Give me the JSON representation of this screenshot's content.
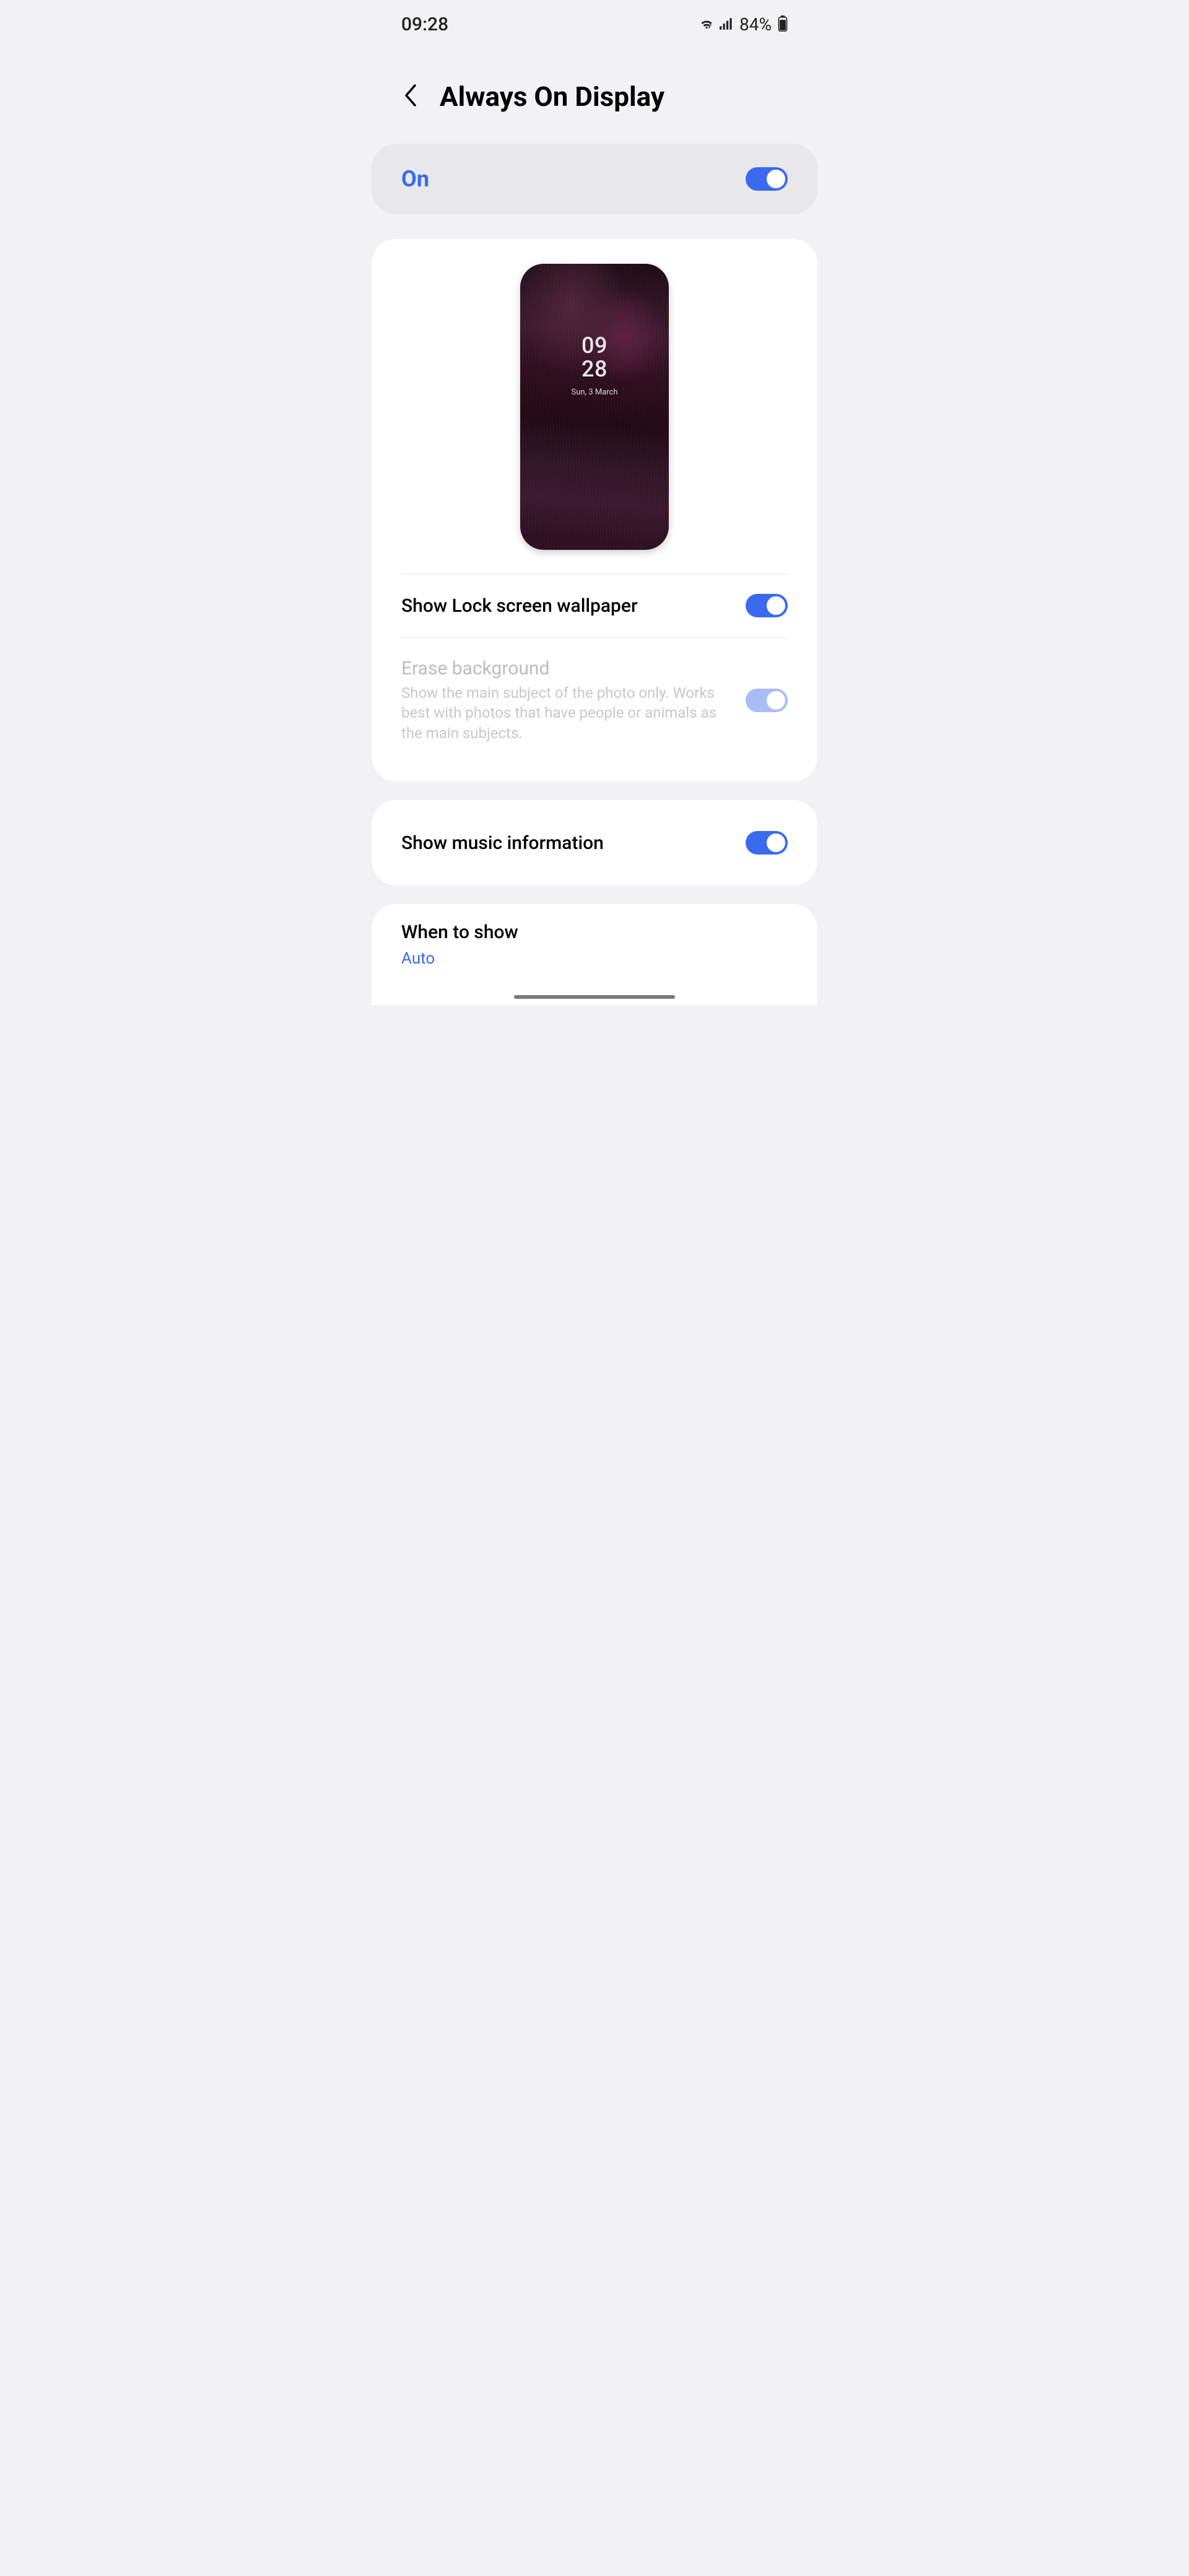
{
  "status": {
    "time": "09:28",
    "battery_pct": "84%"
  },
  "header": {
    "title": "Always On Display"
  },
  "master": {
    "label": "On",
    "on": true
  },
  "preview": {
    "hour": "09",
    "minute": "28",
    "date": "Sun, 3 March"
  },
  "rows": {
    "wallpaper": {
      "title": "Show Lock screen wallpaper",
      "on": true
    },
    "erase": {
      "title": "Erase background",
      "sub": "Show the main subject of the photo only. Works best with photos that have people or animals as the main subjects.",
      "on": true,
      "disabled": true
    },
    "music": {
      "title": "Show music information",
      "on": true
    },
    "when": {
      "title": "When to show",
      "value": "Auto"
    }
  }
}
